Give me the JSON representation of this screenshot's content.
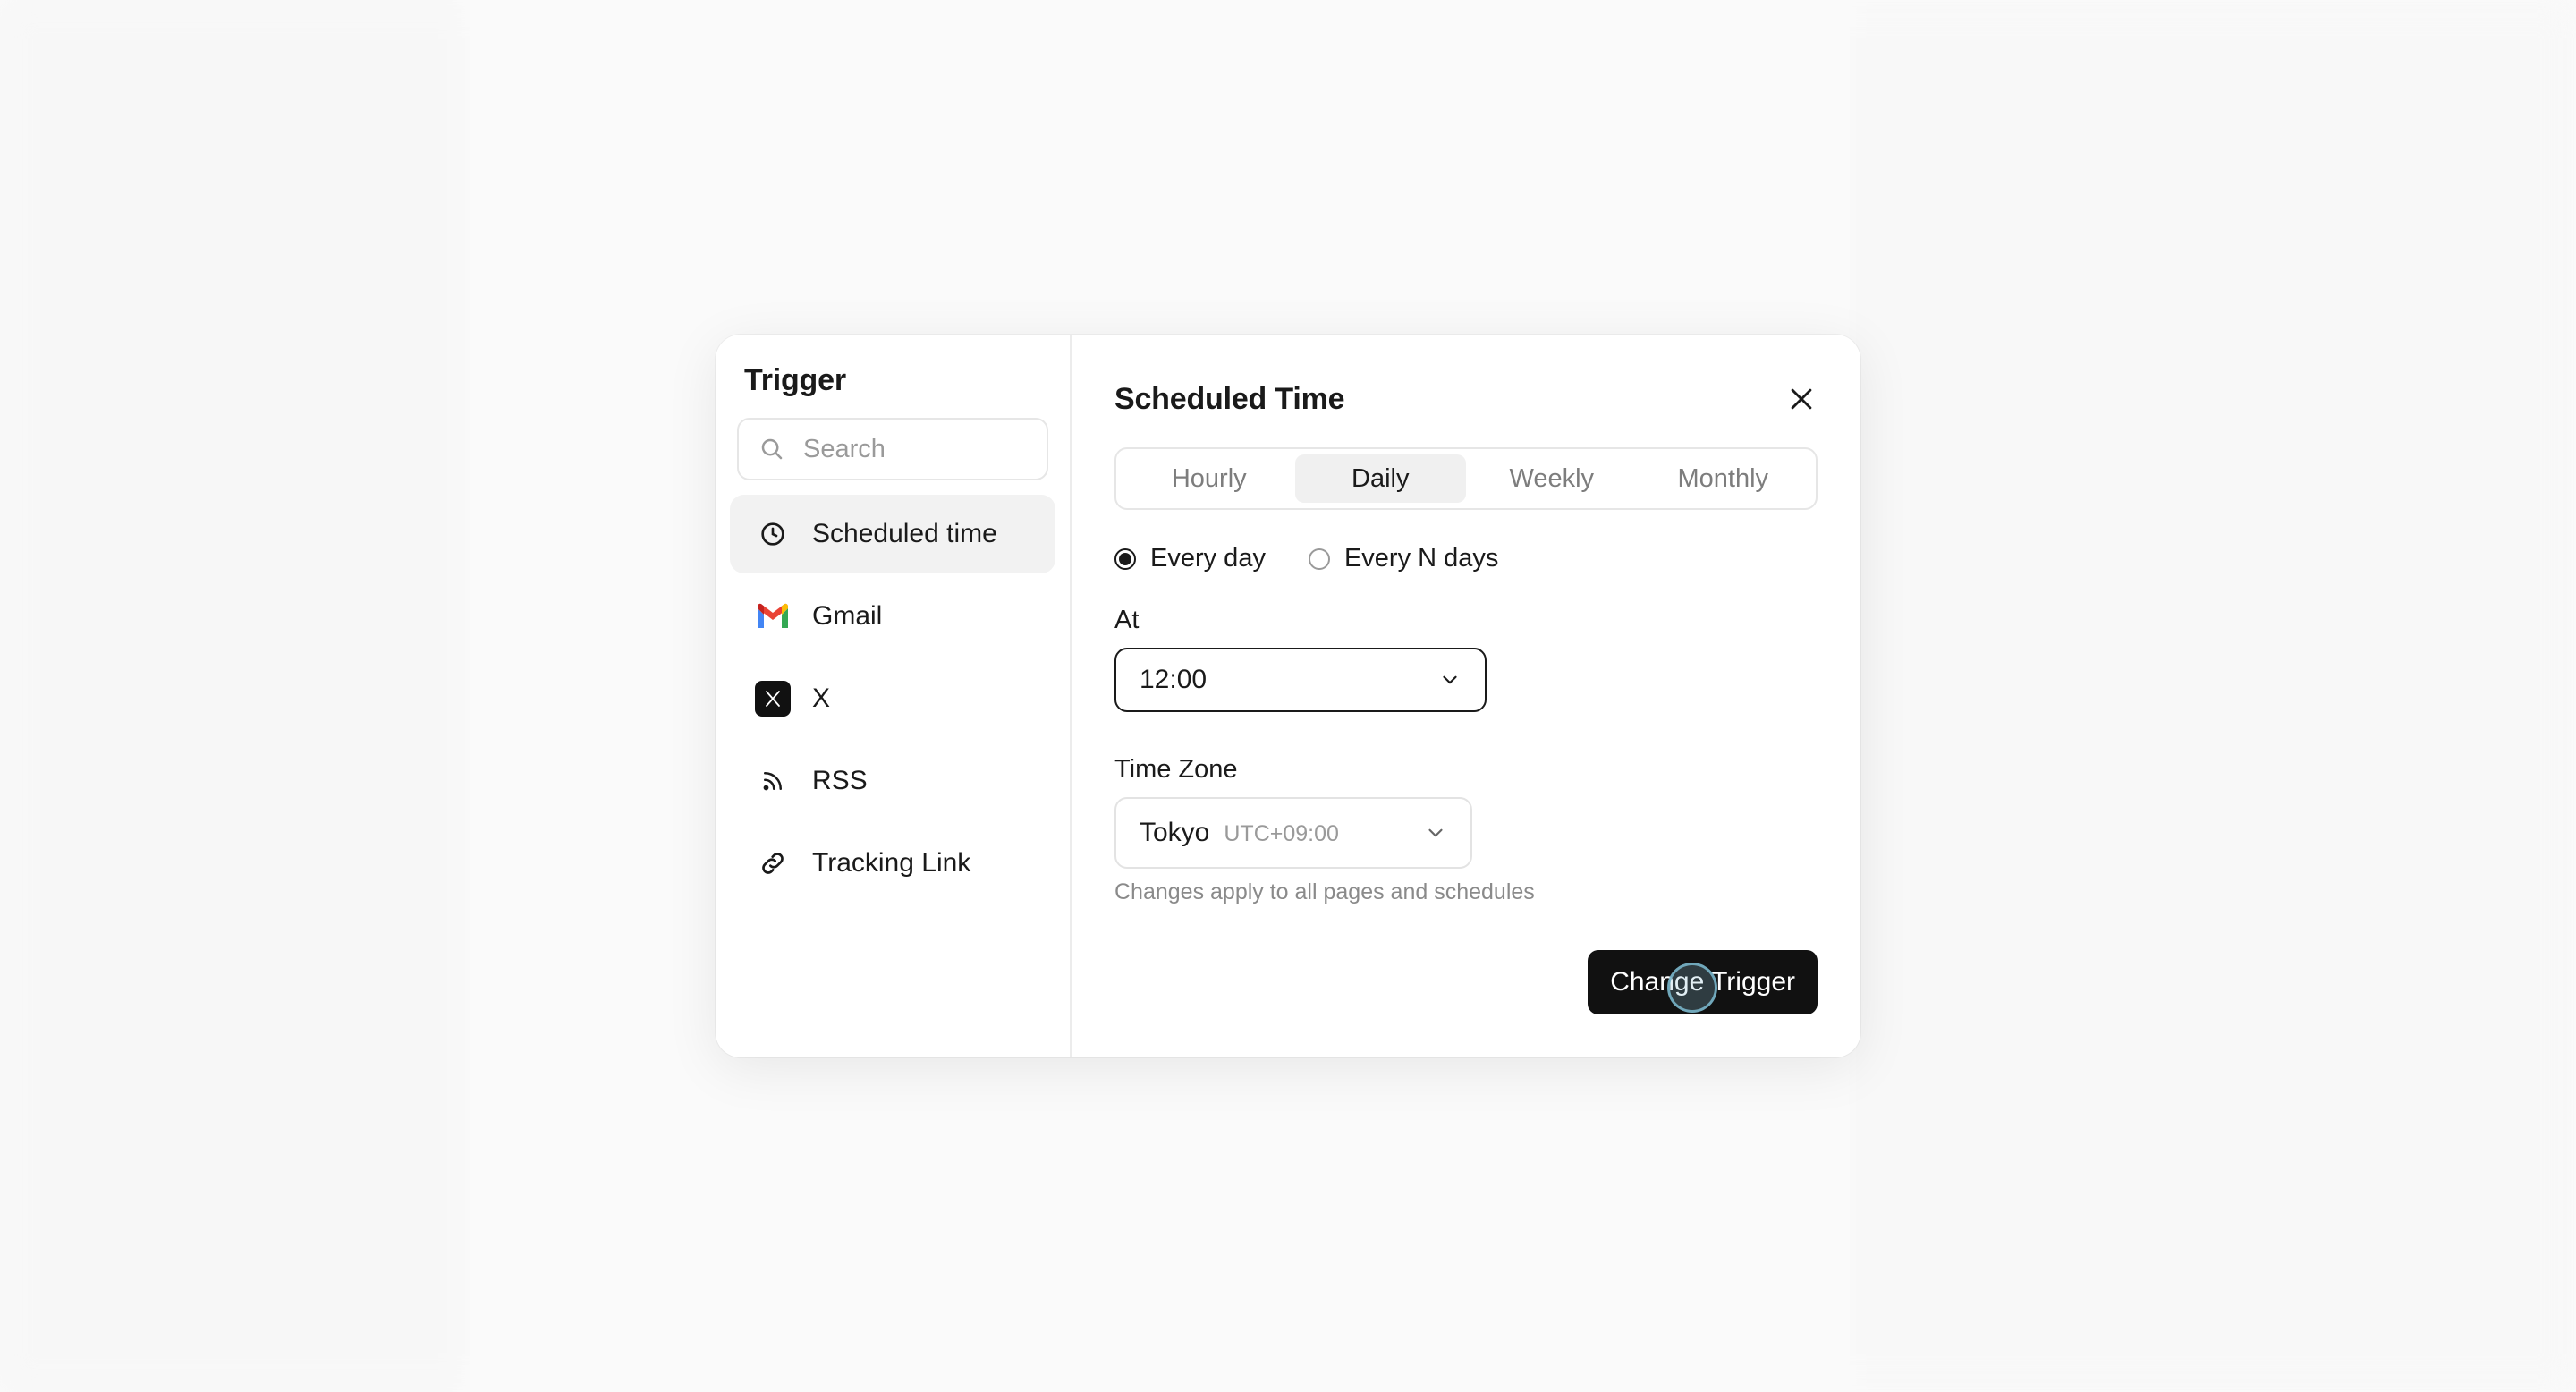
{
  "modal": {
    "left_title": "Trigger",
    "search_placeholder": "Search",
    "triggers": [
      {
        "label": "Scheduled time",
        "icon": "clock-icon",
        "active": true
      },
      {
        "label": "Gmail",
        "icon": "gmail-icon",
        "active": false
      },
      {
        "label": "X",
        "icon": "x-icon",
        "active": false
      },
      {
        "label": "RSS",
        "icon": "rss-icon",
        "active": false
      },
      {
        "label": "Tracking Link",
        "icon": "link-icon",
        "active": false
      }
    ],
    "right_title": "Scheduled Time",
    "tabs": [
      {
        "label": "Hourly",
        "active": false
      },
      {
        "label": "Daily",
        "active": true
      },
      {
        "label": "Weekly",
        "active": false
      },
      {
        "label": "Monthly",
        "active": false
      }
    ],
    "frequency_options": [
      {
        "label": "Every day",
        "checked": true
      },
      {
        "label": "Every N days",
        "checked": false
      }
    ],
    "at_label": "At",
    "at_value": "12:00",
    "timezone_label": "Time Zone",
    "timezone_city": "Tokyo",
    "timezone_offset": "UTC+09:00",
    "timezone_hint": "Changes apply to all pages and schedules",
    "submit_label": "Change Trigger"
  },
  "colors": {
    "primary_button": "#111111",
    "active_tab_bg": "#f0f0f0",
    "gmail_red": "#EA4335",
    "gmail_blue": "#4285F4",
    "gmail_green": "#34A853",
    "gmail_yellow": "#FBBC05"
  }
}
